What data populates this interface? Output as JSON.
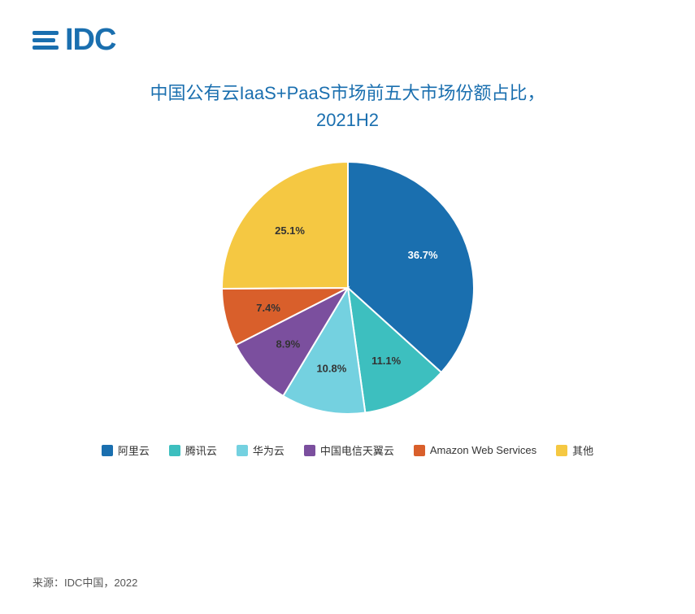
{
  "logo": {
    "text": "IDC"
  },
  "title": {
    "line1": "中国公有云IaaS+PaaS市场前五大市场份额占比，",
    "line2": "2021H2"
  },
  "chart": {
    "segments": [
      {
        "name": "阿里云",
        "value": 36.7,
        "color": "#1a6faf",
        "label": "36.7%",
        "startAngle": -90,
        "endAngle": 42.12
      },
      {
        "name": "腾讯云",
        "value": 11.1,
        "color": "#3dbfbf",
        "label": "11.1%",
        "startAngle": 42.12,
        "endAngle": 82.08
      },
      {
        "name": "华为云",
        "value": 10.8,
        "color": "#74d1e0",
        "label": "10.8%",
        "startAngle": 82.08,
        "endAngle": 120.96
      },
      {
        "name": "中国电信天翼云",
        "value": 8.9,
        "color": "#7b4f9e",
        "label": "8.9%",
        "startAngle": 120.96,
        "endAngle": 153.0
      },
      {
        "name": "Amazon Web Services",
        "value": 7.4,
        "color": "#d95f2b",
        "label": "7.4%",
        "startAngle": 153.0,
        "endAngle": 179.64
      },
      {
        "name": "其他",
        "value": 25.1,
        "color": "#f5c842",
        "label": "25.1%",
        "startAngle": 179.64,
        "endAngle": 270.0
      }
    ]
  },
  "legend": [
    {
      "name": "阿里云",
      "color": "#1a6faf"
    },
    {
      "name": "腾讯云",
      "color": "#3dbfbf"
    },
    {
      "name": "华为云",
      "color": "#74d1e0"
    },
    {
      "name": "中国电信天翼云",
      "color": "#7b4f9e"
    },
    {
      "name": "Amazon Web Services",
      "color": "#d95f2b"
    },
    {
      "name": "其他",
      "color": "#f5c842"
    }
  ],
  "source": "来源：IDC中国，2022"
}
